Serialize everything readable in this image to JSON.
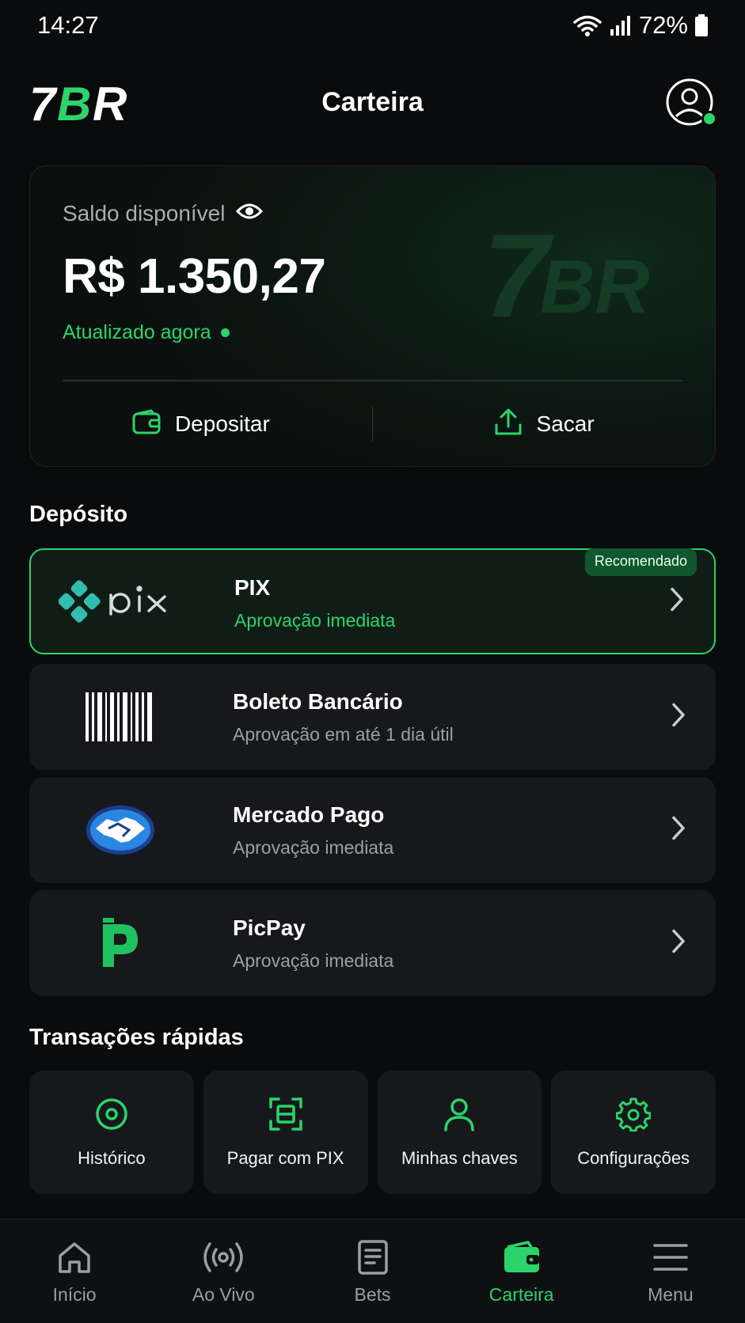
{
  "status_bar": {
    "time": "14:27",
    "battery": "72%"
  },
  "header": {
    "logo_text": "7BR",
    "title": "Carteira"
  },
  "balance": {
    "label": "Saldo disponível",
    "amount": "R$ 1.350,27",
    "updated": "Atualizado agora",
    "deposit_label": "Depositar",
    "withdraw_label": "Sacar"
  },
  "deposit": {
    "title": "Depósito",
    "methods": [
      {
        "name": "PIX",
        "subtitle": "Aprovação imediata",
        "badge": "Recomendado",
        "logo": "pix-logo"
      },
      {
        "name": "Boleto Bancário",
        "subtitle": "Aprovação em até 1 dia útil",
        "logo": "barcode-icon"
      },
      {
        "name": "Mercado Pago",
        "subtitle": "Aprovação imediata",
        "logo": "mercado-pago-logo"
      },
      {
        "name": "PicPay",
        "subtitle": "Aprovação imediata",
        "logo": "picpay-logo"
      }
    ]
  },
  "quick": {
    "title": "Transações rápidas",
    "items": [
      {
        "label": "Histórico",
        "icon": "history-icon"
      },
      {
        "label": "Pagar com PIX",
        "icon": "scan-icon"
      },
      {
        "label": "Minhas chaves",
        "icon": "user-icon"
      },
      {
        "label": "Configurações",
        "icon": "gear-icon"
      }
    ]
  },
  "nav": {
    "items": [
      {
        "label": "Início",
        "icon": "home-icon"
      },
      {
        "label": "Ao Vivo",
        "icon": "live-icon"
      },
      {
        "label": "Bets",
        "icon": "bets-icon"
      },
      {
        "label": "Carteira",
        "icon": "wallet-icon",
        "active": true
      },
      {
        "label": "Menu",
        "icon": "menu-icon"
      }
    ]
  },
  "colors": {
    "accent": "#2bd46b",
    "background": "#0a0b0d",
    "card": "#16181b"
  }
}
